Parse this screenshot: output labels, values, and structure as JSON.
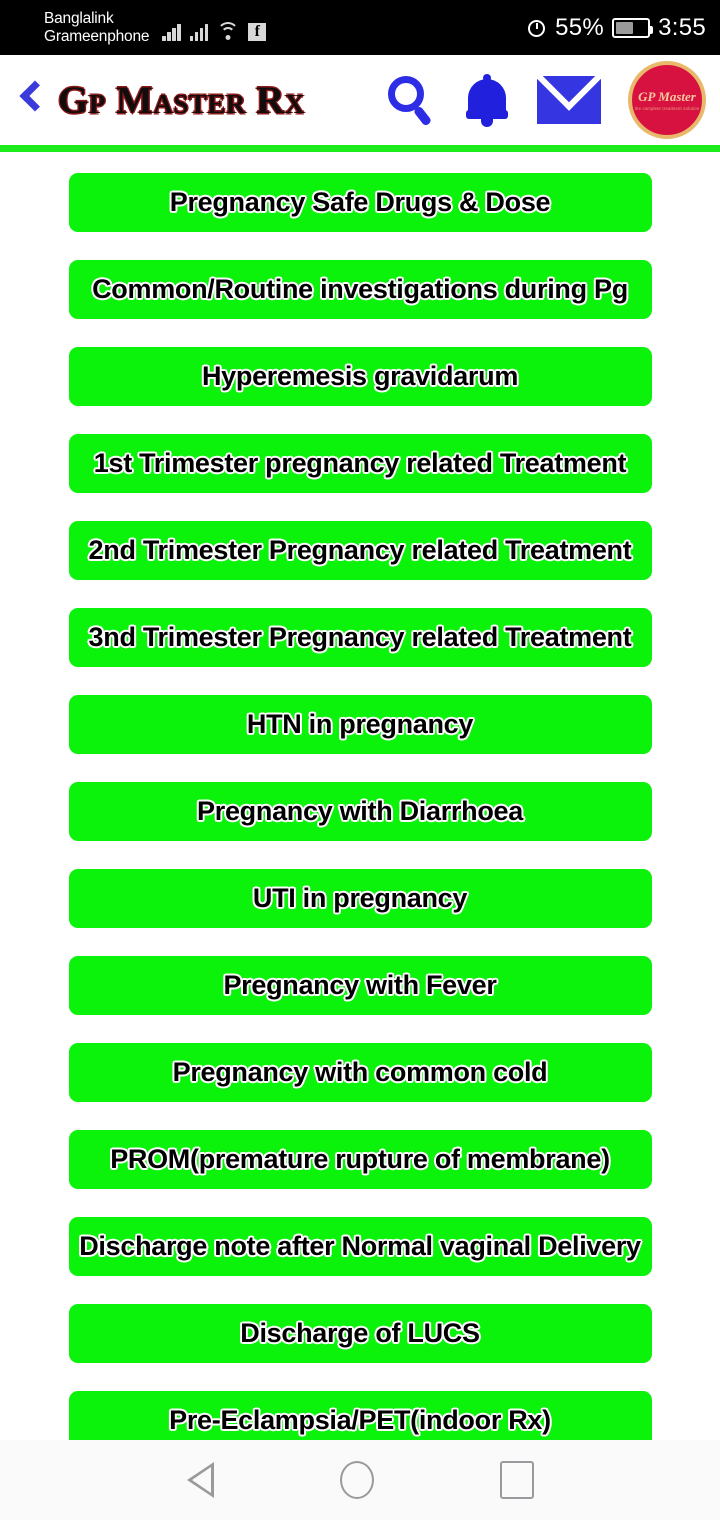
{
  "status_bar": {
    "carrier_line1": "Banglalink",
    "carrier_line2": "Grameenphone",
    "icons": [
      "signal-bars-icon",
      "signal-bars-icon",
      "wifi-icon",
      "facebook-icon"
    ],
    "battery_percent": "55%",
    "battery_level": 55,
    "alarm_icon": "alarm-clock-icon",
    "time": "3:55"
  },
  "header": {
    "back_icon": "back-chevron-icon",
    "title": "Gp Master Rx",
    "search_icon": "search-icon",
    "bell_icon": "bell-icon",
    "mail_icon": "envelope-icon",
    "logo": {
      "name": "gp-master-logo",
      "title": "GP Master",
      "subtitle": "the complete treatment solution",
      "circle_color": "#d81240",
      "ring_color": "#e8b96a"
    },
    "divider_color": "#1cec1c"
  },
  "menu": {
    "button_color": "#0bf20b",
    "items": [
      {
        "label": "Pregnancy Safe Drugs & Dose"
      },
      {
        "label": "Common/Routine investigations during Pg"
      },
      {
        "label": "Hyperemesis gravidarum"
      },
      {
        "label": "1st Trimester pregnancy related Treatment"
      },
      {
        "label": "2nd Trimester Pregnancy related Treatment"
      },
      {
        "label": "3nd Trimester Pregnancy related Treatment"
      },
      {
        "label": "HTN in pregnancy"
      },
      {
        "label": "Pregnancy with Diarrhoea"
      },
      {
        "label": "UTI in pregnancy"
      },
      {
        "label": "Pregnancy with Fever"
      },
      {
        "label": "Pregnancy with common cold"
      },
      {
        "label": "PROM(premature rupture of membrane)"
      },
      {
        "label": "Discharge note after Normal  vaginal Delivery"
      },
      {
        "label": "Discharge of LUCS"
      },
      {
        "label": "Pre-Eclampsia/PET(indoor Rx)"
      }
    ]
  },
  "nav_bar": {
    "back_icon": "nav-back-triangle-icon",
    "home_icon": "nav-home-circle-icon",
    "recents_icon": "nav-recents-square-icon"
  }
}
